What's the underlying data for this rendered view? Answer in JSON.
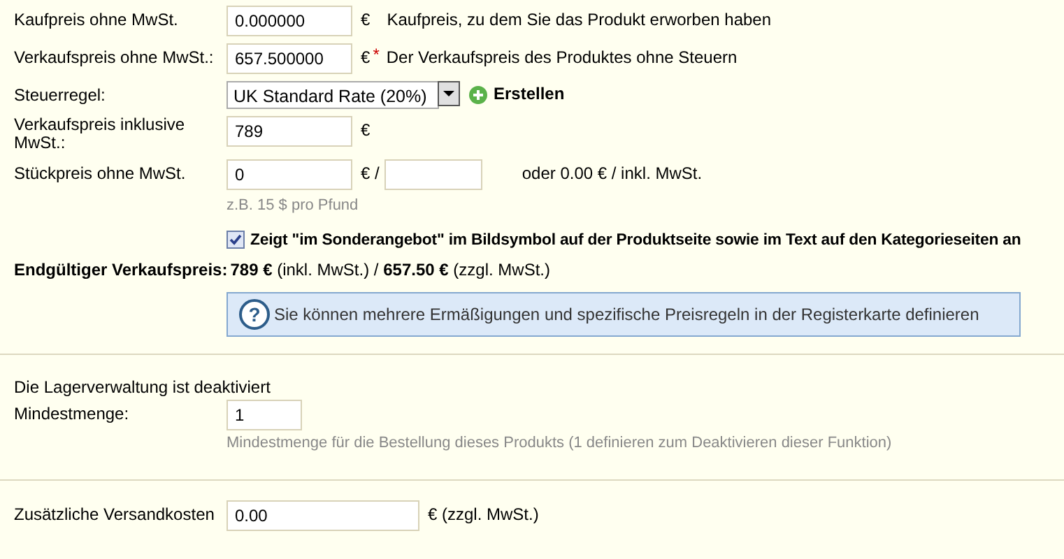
{
  "price_rows": [
    {
      "label": "Kaufpreis ohne MwSt.",
      "value": "0.000000",
      "unit": "€",
      "note": "Kaufpreis, zu dem Sie das Produkt erworben haben"
    },
    {
      "label": "Verkaufspreis ohne MwSt.:",
      "value": "657.500000",
      "unit": "€",
      "required_mark": "*",
      "note": "Der Verkaufspreis des Produktes ohne Steuern"
    }
  ],
  "tax_rule": {
    "label": "Steuerregel:",
    "value": "UK Standard Rate (20%)",
    "create_link": "Erstellen"
  },
  "price_incl": {
    "label": "Verkaufspreis inklusive MwSt.:",
    "value": "789",
    "unit": "€"
  },
  "unit_price": {
    "label": "Stückpreis ohne MwSt.",
    "value": "0",
    "unit": "€ /",
    "note": "oder 0.00 € / inkl. MwSt.",
    "hint": "z.B. 15 $ pro Pfund"
  },
  "on_sale": {
    "checked": true,
    "label": "Zeigt \"im Sonderangebot\" im Bildsymbol auf der Produktseite sowie im Text auf den Kategorieseiten an"
  },
  "final_price": {
    "label": "Endgültiger Verkaufspreis:",
    "value": "**789 €** (inkl. MwSt.) / **657.50 €** (zzgl. MwSt.)"
  },
  "info_icon": "?",
  "info": "Sie können mehrere Ermäßigungen und spezifische Preisregeln in der Registerkarte definieren",
  "stock_notice": "Die Lagerverwaltung ist deaktiviert",
  "min_qty": {
    "label": "Mindestmenge:",
    "value": "1",
    "hint": "Mindestmenge für die Bestellung dieses Produkts (1 definieren zum Deaktivieren dieser Funktion)"
  },
  "shipping": {
    "label": "Zusätzliche Versandkosten",
    "value": "0.00",
    "unit": "€ (zzgl. MwSt.)"
  }
}
